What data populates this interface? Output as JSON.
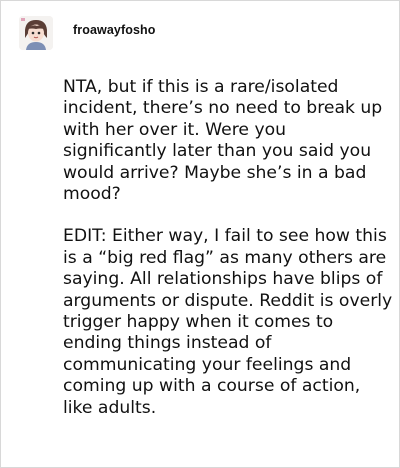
{
  "post": {
    "username": "froawayfosho",
    "paragraphs": [
      "NTA, but if this is a rare/isolated incident, there’s no need to break up with her over it. Were you significantly later than you said you would arrive? Maybe she’s in a bad mood?",
      "EDIT: Either way, I fail to see how this is a “big red flag” as many others are saying. All relationships have blips of arguments or dispute. Reddit is overly trigger happy when it comes to ending things instead of communicating your feelings and coming up with a course of action, like adults."
    ]
  },
  "colors": {
    "background": "#ffffff",
    "text": "#111111",
    "border": "#d8d8d8"
  },
  "icons": {
    "avatar": "user-avatar-drawing"
  }
}
